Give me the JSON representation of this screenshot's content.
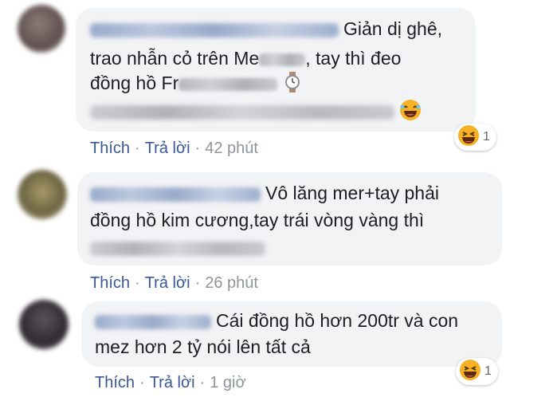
{
  "comments": [
    {
      "text_lines": [
        "Giản dị ghê,",
        "trao nhẫn cỏ trên Me",
        ", tay thì đeo",
        "đồng hồ Fr"
      ],
      "actions": {
        "like": "Thích",
        "reply": "Trả lời",
        "time": "42 phút"
      },
      "reaction_count": "1",
      "reaction_icon": "haha-emoji-icon"
    },
    {
      "text_lines": [
        "Vô lăng mer+tay phải",
        "đồng hồ kim cương,tay trái vòng vàng thì"
      ],
      "actions": {
        "like": "Thích",
        "reply": "Trả lời",
        "time": "26 phút"
      }
    },
    {
      "text_lines": [
        "Cái đồng hồ hơn 200tr và con",
        "mez hơn 2 tỷ nói lên tất cả"
      ],
      "actions": {
        "like": "Thích",
        "reply": "Trả lời",
        "time": "1 giờ"
      },
      "reaction_count": "1",
      "reaction_icon": "haha-emoji-icon"
    }
  ],
  "separator": "·",
  "colors": {
    "bubble": "#f2f3f5",
    "link": "#385898",
    "meta": "#90949c",
    "text": "#1c1e21",
    "emoji_yellow": "#f7b125"
  }
}
